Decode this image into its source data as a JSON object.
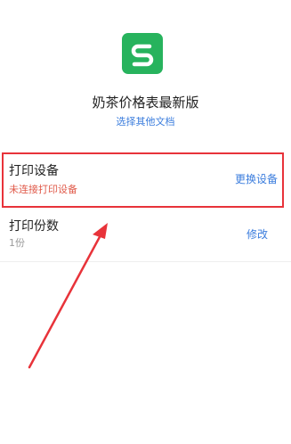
{
  "document": {
    "title": "奶茶价格表最新版",
    "choose_other_link": "选择其他文档",
    "app_icon": "wps-s-icon",
    "app_icon_color": "#27b35d"
  },
  "printer": {
    "label": "打印设备",
    "status": "未连接打印设备",
    "status_color": "#e05a4a",
    "action": "更换设备"
  },
  "copies": {
    "label": "打印份数",
    "value": "1份",
    "action": "修改"
  },
  "annotation": {
    "highlight_color": "#e8333a",
    "arrow_color": "#e8333a"
  }
}
